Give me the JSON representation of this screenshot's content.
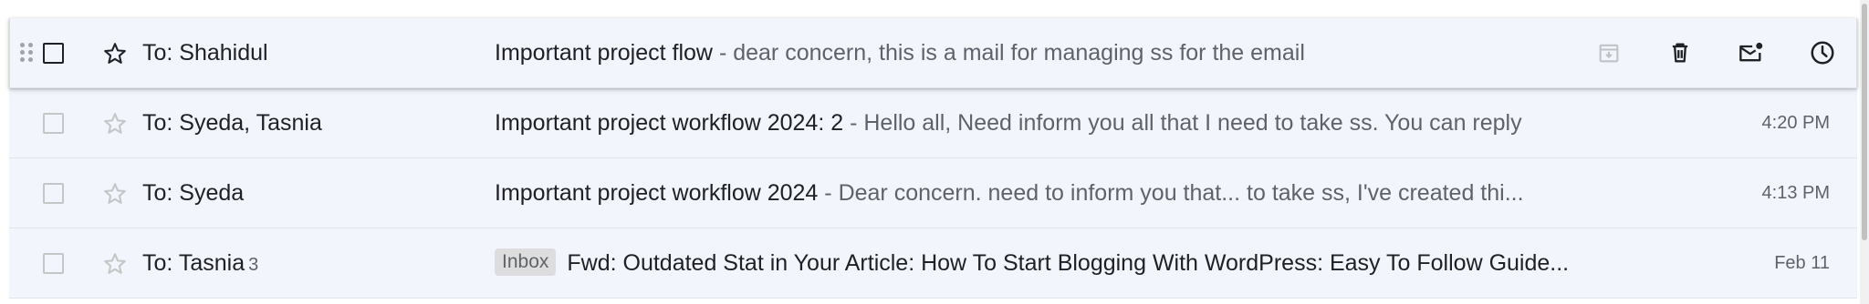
{
  "emails": [
    {
      "sender": "To: Shahidul",
      "count": "",
      "label": "",
      "subject": "Important project flow",
      "snippet": "dear concern, this is a mail for managing ss for the email",
      "time": ""
    },
    {
      "sender": "To: Syeda, Tasnia",
      "count": "",
      "label": "",
      "subject": "Important project workflow 2024: 2",
      "snippet": "Hello all, Need inform you all that I need to take ss. You can reply",
      "time": "4:20 PM"
    },
    {
      "sender": "To: Syeda",
      "count": "",
      "label": "",
      "subject": "Important project workflow 2024",
      "snippet": "Dear concern. need to inform you that... to take ss, I've created thi...",
      "time": "4:13 PM"
    },
    {
      "sender": "To: Tasnia",
      "count": "3",
      "label": "Inbox",
      "subject": "Fwd: Outdated Stat in Your Article: How To Start Blogging With WordPress: Easy To Follow Guide...",
      "snippet": "",
      "time": "Feb 11"
    }
  ],
  "separator": " - ",
  "hover_actions": [
    "archive-icon",
    "delete-icon",
    "mark-unread-icon",
    "snooze-icon"
  ]
}
